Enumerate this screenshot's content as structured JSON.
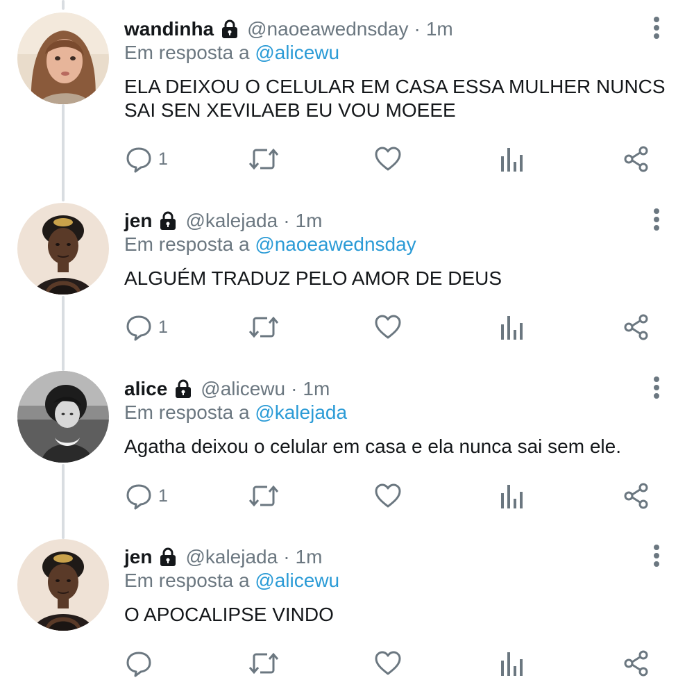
{
  "colors": {
    "mention": "#2b9bd6",
    "muted": "#6b7780",
    "text": "#14171a",
    "thread_line": "#d9dde1"
  },
  "icons": {
    "lock": "lock-icon",
    "more": "vertical-dots-icon",
    "reply": "reply-bubble-icon",
    "retweet": "retweet-icon",
    "like": "heart-icon",
    "stats": "bar-stats-icon",
    "share": "share-icon"
  },
  "tweets": [
    {
      "name": "wandinha",
      "handle": "@naoeawednsday",
      "separator": "·",
      "time": "1m",
      "reply_prefix": "Em resposta a",
      "reply_to": "@alicewu",
      "text": "ELA DEIXOU O CELULAR EM CASA ESSA MULHER NUNCS SAI SEN XEVILAEB EU VOU MOEEE",
      "reply_count": "1"
    },
    {
      "name": "jen",
      "handle": "@kalejada",
      "separator": "·",
      "time": "1m",
      "reply_prefix": "Em resposta a",
      "reply_to": "@naoeawednsday",
      "text": "ALGUÉM TRADUZ PELO AMOR DE DEUS",
      "reply_count": "1"
    },
    {
      "name": "alice",
      "handle": "@alicewu",
      "separator": "·",
      "time": "1m",
      "reply_prefix": "Em resposta a",
      "reply_to": "@kalejada",
      "text": "Agatha deixou o celular em casa e ela nunca sai sem ele.",
      "reply_count": "1"
    },
    {
      "name": "jen",
      "handle": "@kalejada",
      "separator": "·",
      "time": "1m",
      "reply_prefix": "Em resposta a",
      "reply_to": "@alicewu",
      "text": "O APOCALIPSE VINDO",
      "reply_count": ""
    }
  ]
}
